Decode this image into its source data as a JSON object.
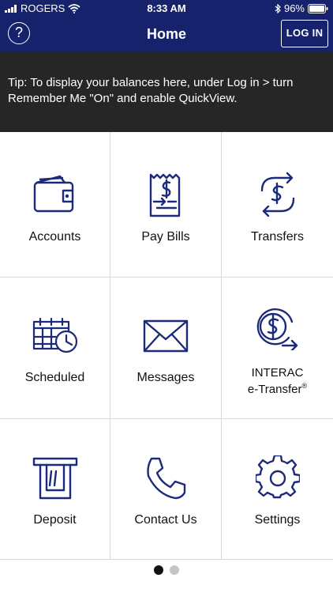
{
  "status_bar": {
    "carrier": "ROGERS",
    "time": "8:33 AM",
    "battery": "96%"
  },
  "nav": {
    "title": "Home",
    "help_label": "?",
    "login_label": "LOG IN"
  },
  "tip": "Tip: To display your balances here, under Log in > turn Remember Me \"On\" and enable QuickView.",
  "tiles": [
    {
      "label": "Accounts",
      "icon": "wallet-icon"
    },
    {
      "label": "Pay Bills",
      "icon": "bill-payment-icon"
    },
    {
      "label": "Transfers",
      "icon": "transfer-icon"
    },
    {
      "label": "Scheduled",
      "icon": "calendar-clock-icon"
    },
    {
      "label": "Messages",
      "icon": "envelope-icon"
    },
    {
      "label_line1": "INTERAC",
      "label_line2": "e-Transfer",
      "label_sup": "®",
      "icon": "etransfer-icon"
    },
    {
      "label": "Deposit",
      "icon": "atm-deposit-icon"
    },
    {
      "label": "Contact Us",
      "icon": "phone-icon"
    },
    {
      "label": "Settings",
      "icon": "gear-icon"
    }
  ],
  "pager": {
    "pages": 2,
    "current": 1
  },
  "colors": {
    "navy": "#16226b",
    "tip_bg": "#262626",
    "icon": "#1b2a7a",
    "divider": "#d8d8d8"
  }
}
